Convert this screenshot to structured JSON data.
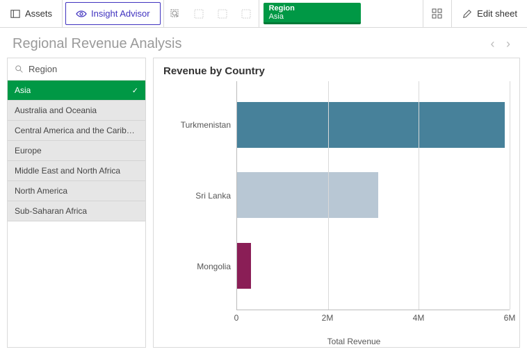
{
  "toolbar": {
    "assets_label": "Assets",
    "insight_label": "Insight Advisor",
    "edit_label": "Edit sheet"
  },
  "filter_pill": {
    "field": "Region",
    "value": "Asia"
  },
  "sheet_title": "Regional Revenue Analysis",
  "filterpane": {
    "field_label": "Region",
    "items": [
      {
        "label": "Asia",
        "selected": true
      },
      {
        "label": "Australia and Oceania",
        "selected": false
      },
      {
        "label": "Central America and the Carib…",
        "selected": false
      },
      {
        "label": "Europe",
        "selected": false
      },
      {
        "label": "Middle East and North Africa",
        "selected": false
      },
      {
        "label": "North America",
        "selected": false
      },
      {
        "label": "Sub-Saharan Africa",
        "selected": false
      }
    ]
  },
  "chart": {
    "title": "Revenue by Country",
    "xlabel": "Total Revenue",
    "xticks": [
      "0",
      "2M",
      "4M",
      "6M"
    ]
  },
  "chart_data": {
    "type": "bar",
    "orientation": "horizontal",
    "categories": [
      "Turkmenistan",
      "Sri Lanka",
      "Mongolia"
    ],
    "values": [
      5900000,
      3100000,
      300000
    ],
    "colors": [
      "#47819a",
      "#b8c7d4",
      "#8a1e56"
    ],
    "title": "Revenue by Country",
    "xlabel": "Total Revenue",
    "ylabel": "",
    "xlim": [
      0,
      6000000
    ]
  }
}
